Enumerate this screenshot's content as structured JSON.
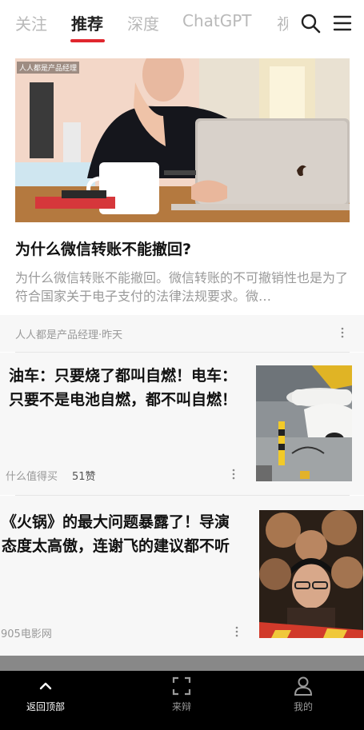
{
  "nav": {
    "tabs": [
      {
        "label": "关注"
      },
      {
        "label": "推荐"
      },
      {
        "label": "深度"
      },
      {
        "label": "ChatGPT"
      },
      {
        "label": "视"
      }
    ],
    "active_index": 1,
    "accent": "#e0262e",
    "search_icon": "search-icon",
    "menu_icon": "menu-icon"
  },
  "feed": [
    {
      "title": "为什么微信转账不能撤回?",
      "summary": "为什么微信转账不能撤回。微信转账的不可撤销性也是为了符合国家关于电子支付的法律法规要求。微…",
      "image_logo_text": "人人都是产品经理",
      "source": "人人都是产品经理",
      "time": "昨天",
      "separator": "·"
    },
    {
      "title": "油车：只要烧了都叫自燃！电车：只要不是电池自燃，都不叫自燃！",
      "source": "什么值得买",
      "likes": "51赞"
    },
    {
      "title": "《火锅》的最大问题暴露了！导演态度太高傲，连谢飞的建议都不听",
      "source": "905电影网"
    }
  ],
  "bottom_bar": {
    "items": [
      {
        "label": "返回顶部",
        "icon": "chevron-up-icon"
      },
      {
        "label": "来辩",
        "icon": "scan-icon"
      },
      {
        "label": "我的",
        "icon": "user-icon"
      }
    ]
  }
}
